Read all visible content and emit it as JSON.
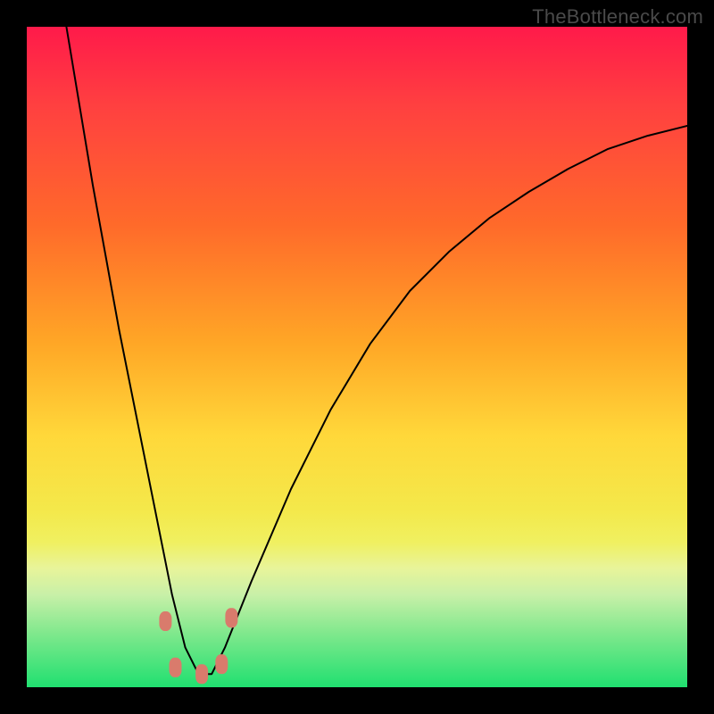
{
  "watermark": "TheBottleneck.com",
  "colors": {
    "frame_bg": "#000000",
    "gradient_top": "#ff1a4a",
    "gradient_bottom": "#20e070",
    "curve_stroke": "#000000",
    "marker_fill": "#d97b6c"
  },
  "chart_data": {
    "type": "line",
    "title": "",
    "xlabel": "",
    "ylabel": "",
    "xlim": [
      0,
      100
    ],
    "ylim": [
      0,
      100
    ],
    "note": "Axes unlabeled in source; x is relative horizontal position (0–100 left→right), y is relative vertical position (0 bottom, 100 top). Values are read off the plot geometry.",
    "series": [
      {
        "name": "bottleneck-curve",
        "x": [
          6.0,
          10.0,
          14.0,
          18.0,
          20.0,
          22.0,
          24.0,
          26.0,
          28.0,
          30.0,
          34.0,
          40.0,
          46.0,
          52.0,
          58.0,
          64.0,
          70.0,
          76.0,
          82.0,
          88.0,
          94.0,
          100.0
        ],
        "y": [
          100.0,
          76.0,
          54.0,
          34.0,
          24.0,
          14.0,
          6.0,
          2.0,
          2.0,
          6.0,
          16.0,
          30.0,
          42.0,
          52.0,
          60.0,
          66.0,
          71.0,
          75.0,
          78.5,
          81.5,
          83.5,
          85.0
        ]
      }
    ],
    "markers": [
      {
        "x": 21.0,
        "y": 10.0
      },
      {
        "x": 22.5,
        "y": 3.0
      },
      {
        "x": 26.5,
        "y": 2.0
      },
      {
        "x": 29.5,
        "y": 3.5
      },
      {
        "x": 31.0,
        "y": 10.5
      }
    ],
    "marker_shape": "rounded-rect",
    "marker_size_px": {
      "w": 14,
      "h": 22
    }
  }
}
